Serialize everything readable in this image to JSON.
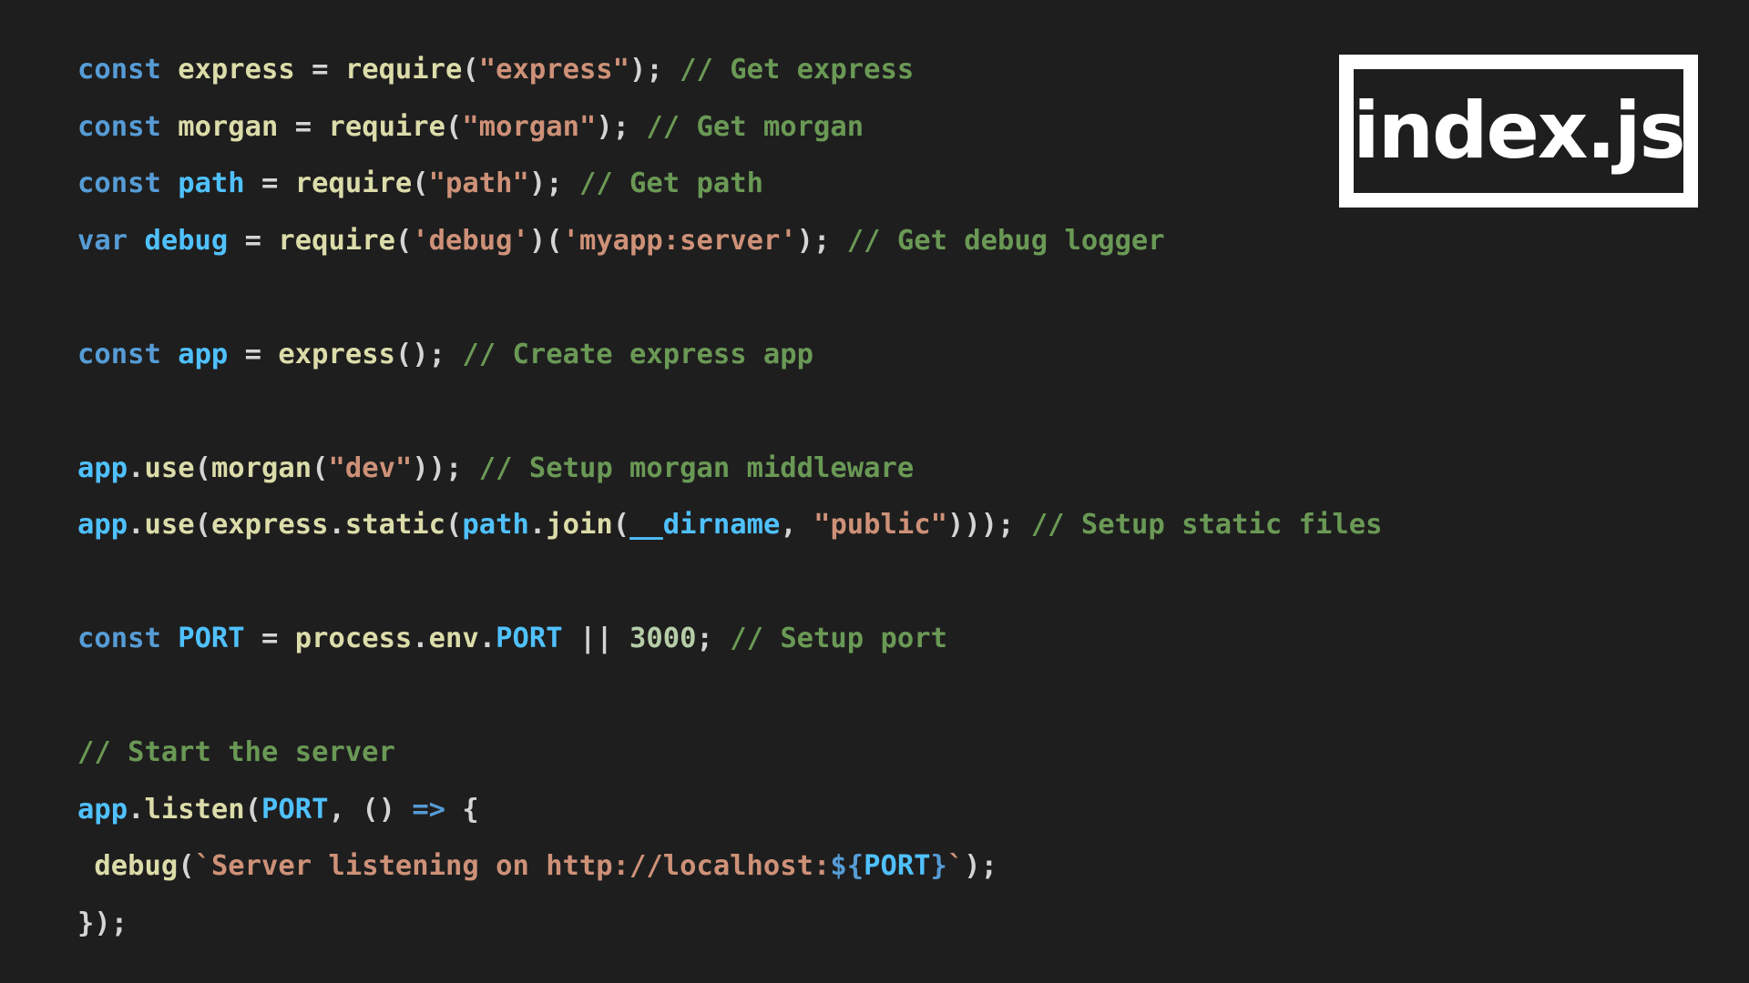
{
  "file_badge": {
    "label": "index.js"
  },
  "colors": {
    "keyword": "#569cd6",
    "variable": "#4fc1ff",
    "identifier": "#dcdcaa",
    "string": "#ce9178",
    "comment": "#6a9955",
    "number": "#b5cea8",
    "punctuation": "#d4d4d4",
    "background": "#1e1e1e"
  },
  "code_lines": [
    [
      {
        "t": "const",
        "k": "keyword"
      },
      {
        "t": " ",
        "k": "punctuation"
      },
      {
        "t": "express",
        "k": "identifier"
      },
      {
        "t": " = ",
        "k": "punctuation"
      },
      {
        "t": "require",
        "k": "identifier"
      },
      {
        "t": "(",
        "k": "punctuation"
      },
      {
        "t": "\"express\"",
        "k": "string"
      },
      {
        "t": "); ",
        "k": "punctuation"
      },
      {
        "t": "// Get express",
        "k": "comment"
      }
    ],
    [
      {
        "t": "const",
        "k": "keyword"
      },
      {
        "t": " ",
        "k": "punctuation"
      },
      {
        "t": "morgan",
        "k": "identifier"
      },
      {
        "t": " = ",
        "k": "punctuation"
      },
      {
        "t": "require",
        "k": "identifier"
      },
      {
        "t": "(",
        "k": "punctuation"
      },
      {
        "t": "\"morgan\"",
        "k": "string"
      },
      {
        "t": "); ",
        "k": "punctuation"
      },
      {
        "t": "// Get morgan",
        "k": "comment"
      }
    ],
    [
      {
        "t": "const",
        "k": "keyword"
      },
      {
        "t": " ",
        "k": "punctuation"
      },
      {
        "t": "path",
        "k": "variable"
      },
      {
        "t": " = ",
        "k": "punctuation"
      },
      {
        "t": "require",
        "k": "identifier"
      },
      {
        "t": "(",
        "k": "punctuation"
      },
      {
        "t": "\"path\"",
        "k": "string"
      },
      {
        "t": "); ",
        "k": "punctuation"
      },
      {
        "t": "// Get path",
        "k": "comment"
      }
    ],
    [
      {
        "t": "var",
        "k": "keyword"
      },
      {
        "t": " ",
        "k": "punctuation"
      },
      {
        "t": "debug",
        "k": "variable"
      },
      {
        "t": " = ",
        "k": "punctuation"
      },
      {
        "t": "require",
        "k": "identifier"
      },
      {
        "t": "(",
        "k": "punctuation"
      },
      {
        "t": "'debug'",
        "k": "string"
      },
      {
        "t": ")(",
        "k": "punctuation"
      },
      {
        "t": "'myapp:server'",
        "k": "string"
      },
      {
        "t": "); ",
        "k": "punctuation"
      },
      {
        "t": "// Get debug logger",
        "k": "comment"
      }
    ],
    [],
    [
      {
        "t": "const",
        "k": "keyword"
      },
      {
        "t": " ",
        "k": "punctuation"
      },
      {
        "t": "app",
        "k": "variable"
      },
      {
        "t": " = ",
        "k": "punctuation"
      },
      {
        "t": "express",
        "k": "identifier"
      },
      {
        "t": "(); ",
        "k": "punctuation"
      },
      {
        "t": "// Create express app",
        "k": "comment"
      }
    ],
    [],
    [
      {
        "t": "app",
        "k": "variable"
      },
      {
        "t": ".",
        "k": "punctuation"
      },
      {
        "t": "use",
        "k": "identifier"
      },
      {
        "t": "(",
        "k": "punctuation"
      },
      {
        "t": "morgan",
        "k": "identifier"
      },
      {
        "t": "(",
        "k": "punctuation"
      },
      {
        "t": "\"dev\"",
        "k": "string"
      },
      {
        "t": ")); ",
        "k": "punctuation"
      },
      {
        "t": "// Setup morgan middleware",
        "k": "comment"
      }
    ],
    [
      {
        "t": "app",
        "k": "variable"
      },
      {
        "t": ".",
        "k": "punctuation"
      },
      {
        "t": "use",
        "k": "identifier"
      },
      {
        "t": "(",
        "k": "punctuation"
      },
      {
        "t": "express",
        "k": "identifier"
      },
      {
        "t": ".",
        "k": "punctuation"
      },
      {
        "t": "static",
        "k": "identifier"
      },
      {
        "t": "(",
        "k": "punctuation"
      },
      {
        "t": "path",
        "k": "variable"
      },
      {
        "t": ".",
        "k": "punctuation"
      },
      {
        "t": "join",
        "k": "identifier"
      },
      {
        "t": "(",
        "k": "punctuation"
      },
      {
        "t": "__dirname",
        "k": "variable"
      },
      {
        "t": ", ",
        "k": "punctuation"
      },
      {
        "t": "\"public\"",
        "k": "string"
      },
      {
        "t": "))); ",
        "k": "punctuation"
      },
      {
        "t": "// Setup static files",
        "k": "comment"
      }
    ],
    [],
    [
      {
        "t": "const",
        "k": "keyword"
      },
      {
        "t": " ",
        "k": "punctuation"
      },
      {
        "t": "PORT",
        "k": "variable"
      },
      {
        "t": " = ",
        "k": "punctuation"
      },
      {
        "t": "process",
        "k": "identifier"
      },
      {
        "t": ".",
        "k": "punctuation"
      },
      {
        "t": "env",
        "k": "identifier"
      },
      {
        "t": ".",
        "k": "punctuation"
      },
      {
        "t": "PORT",
        "k": "variable"
      },
      {
        "t": " || ",
        "k": "punctuation"
      },
      {
        "t": "3000",
        "k": "number"
      },
      {
        "t": "; ",
        "k": "punctuation"
      },
      {
        "t": "// Setup port",
        "k": "comment"
      }
    ],
    [],
    [
      {
        "t": "// Start the server",
        "k": "comment"
      }
    ],
    [
      {
        "t": "app",
        "k": "variable"
      },
      {
        "t": ".",
        "k": "punctuation"
      },
      {
        "t": "listen",
        "k": "identifier"
      },
      {
        "t": "(",
        "k": "punctuation"
      },
      {
        "t": "PORT",
        "k": "variable"
      },
      {
        "t": ", () ",
        "k": "punctuation"
      },
      {
        "t": "=>",
        "k": "keyword"
      },
      {
        "t": " {",
        "k": "punctuation"
      }
    ],
    [
      {
        "t": " ",
        "k": "punctuation"
      },
      {
        "t": "debug",
        "k": "identifier"
      },
      {
        "t": "(",
        "k": "punctuation"
      },
      {
        "t": "`Server listening on http://localhost:",
        "k": "string"
      },
      {
        "t": "${",
        "k": "keyword"
      },
      {
        "t": "PORT",
        "k": "variable"
      },
      {
        "t": "}",
        "k": "keyword"
      },
      {
        "t": "`",
        "k": "string"
      },
      {
        "t": ");",
        "k": "punctuation"
      }
    ],
    [
      {
        "t": "});",
        "k": "punctuation"
      }
    ]
  ]
}
